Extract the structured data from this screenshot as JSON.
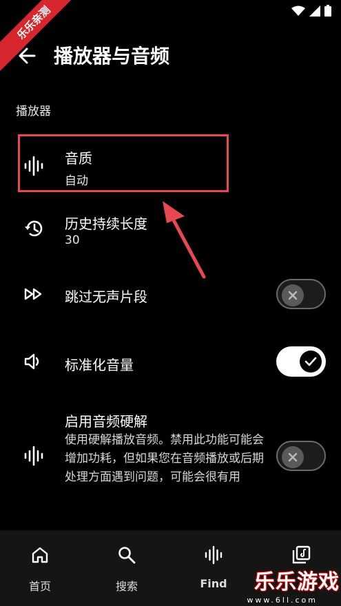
{
  "ribbon": "乐乐亲测",
  "header": {
    "title": "播放器与音频"
  },
  "section": {
    "title": "播放器"
  },
  "items": [
    {
      "label": "音质",
      "value": "自动",
      "icon": "waveform-icon"
    },
    {
      "label": "历史持续长度",
      "value": "30",
      "icon": "history-icon"
    },
    {
      "label": "跳过无声片段",
      "toggle": false,
      "icon": "fast-forward-icon"
    },
    {
      "label": "标准化音量",
      "toggle": true,
      "icon": "volume-icon"
    },
    {
      "label": "启用音频硬解",
      "description": "使用硬解播放音频。禁用此功能可能会增加功耗，但如果您在音频播放或后期处理方面遇到问题，可能会很有用",
      "toggle": false,
      "icon": "waveform-icon"
    }
  ],
  "nav": [
    {
      "label": "首页",
      "icon": "home-icon"
    },
    {
      "label": "搜索",
      "icon": "search-icon"
    },
    {
      "label": "Find",
      "icon": "waveform-icon"
    },
    {
      "label": "",
      "icon": "library-icon"
    }
  ],
  "watermark": {
    "brand": "乐乐游戏",
    "url": "www.6ll.com"
  },
  "colors": {
    "background": "#000000",
    "highlight": "#e8484f",
    "arrow": "#e8484f",
    "nav_background": "#151515"
  }
}
